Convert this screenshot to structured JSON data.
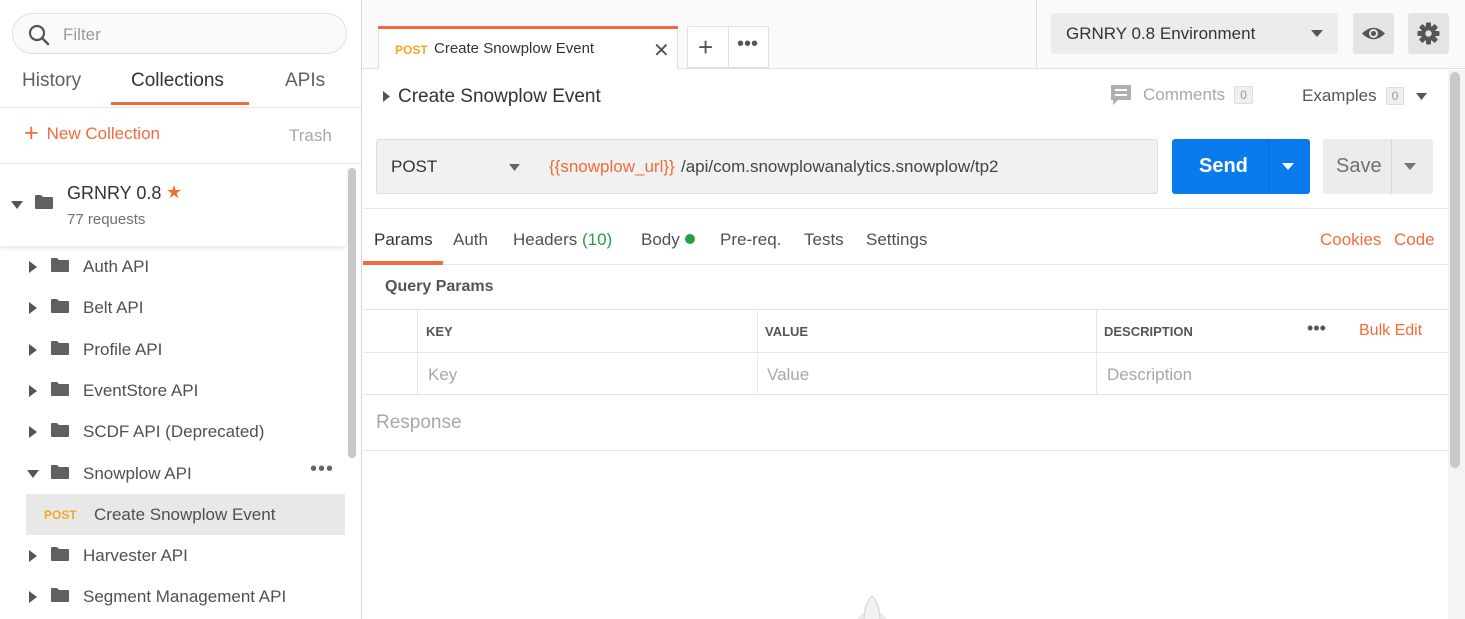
{
  "sidebar": {
    "filter_placeholder": "Filter",
    "tabs": [
      "History",
      "Collections",
      "APIs"
    ],
    "active_tab": "Collections",
    "new_collection": "New Collection",
    "trash": "Trash",
    "collection": {
      "name": "GRNRY 0.8",
      "requests": "77 requests"
    },
    "folders": [
      "Auth API",
      "Belt API",
      "Profile API",
      "EventStore API",
      "SCDF API (Deprecated)",
      "Snowplow API",
      "Harvester API",
      "Segment Management API"
    ],
    "open_request": {
      "method": "POST",
      "name": "Create Snowplow Event"
    }
  },
  "tab": {
    "method": "POST",
    "name": "Create Snowplow Event"
  },
  "environment": {
    "selected": "GRNRY 0.8 Environment"
  },
  "request": {
    "title": "Create Snowplow Event",
    "comments_label": "Comments",
    "comments_count": "0",
    "examples_label": "Examples",
    "examples_count": "0",
    "method": "POST",
    "url_variable": "{{snowplow_url}}",
    "url_path": "/api/com.snowplowanalytics.snowplow/tp2",
    "send": "Send",
    "save": "Save"
  },
  "request_tabs": {
    "params": "Params",
    "auth": "Auth",
    "headers": "Headers",
    "headers_count": "(10)",
    "body": "Body",
    "prereq": "Pre-req.",
    "tests": "Tests",
    "settings": "Settings",
    "cookies": "Cookies",
    "code": "Code"
  },
  "query_params": {
    "title": "Query Params",
    "headers": [
      "KEY",
      "VALUE",
      "DESCRIPTION"
    ],
    "bulk_edit": "Bulk Edit",
    "placeholders": [
      "Key",
      "Value",
      "Description"
    ]
  },
  "response": {
    "label": "Response"
  },
  "colors": {
    "accent": "#f26b3a",
    "send": "#097bed",
    "post": "#f5a623",
    "body_dot": "#26a040"
  }
}
